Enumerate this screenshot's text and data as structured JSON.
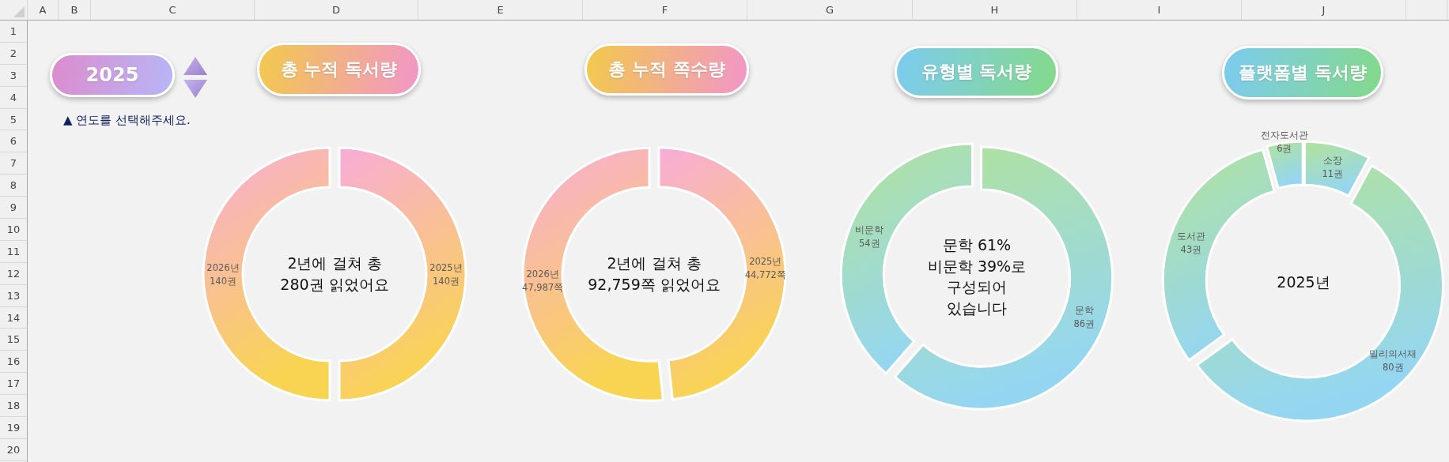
{
  "sheet": {
    "columns": [
      "A",
      "B",
      "C",
      "D",
      "E",
      "F",
      "G",
      "H",
      "I",
      "J",
      ""
    ],
    "rows": [
      "1",
      "2",
      "3",
      "4",
      "5",
      "6",
      "7",
      "8",
      "9",
      "10",
      "11",
      "12",
      "13",
      "14",
      "15",
      "16",
      "17",
      "18",
      "19",
      "20"
    ]
  },
  "year_selector": {
    "value": "2025",
    "hint": "▲ 연도를 선택해주세요."
  },
  "charts": [
    {
      "title": "총 누적 독서량",
      "kind": "warm",
      "center_text": [
        "2년에 걸쳐 총",
        "280권 읽었어요"
      ],
      "chart_data": {
        "type": "donut",
        "categories": [
          "2025년",
          "2026년"
        ],
        "values": [
          140,
          140
        ],
        "value_labels": [
          "140권",
          "140권"
        ]
      }
    },
    {
      "title": "총 누적 쪽수량",
      "kind": "warm",
      "center_text": [
        "2년에 걸쳐 총",
        "92,759쪽 읽었어요"
      ],
      "chart_data": {
        "type": "donut",
        "categories": [
          "2025년",
          "2026년"
        ],
        "values": [
          44772,
          47987
        ],
        "value_labels": [
          "44,772쪽",
          "47,987쪽"
        ]
      }
    },
    {
      "title": "유형별 독서량",
      "kind": "cool",
      "center_text": [
        "문학 61%",
        "비문학 39%로",
        "구성되어",
        "있습니다"
      ],
      "chart_data": {
        "type": "donut",
        "categories": [
          "문학",
          "비문학"
        ],
        "values": [
          86,
          54
        ],
        "value_labels": [
          "86권",
          "54권"
        ]
      }
    },
    {
      "title": "플랫폼별 독서량",
      "kind": "cool",
      "center_text": [
        "2025년"
      ],
      "chart_data": {
        "type": "donut",
        "categories": [
          "소장",
          "밀리의서재",
          "도서관",
          "전자도서관"
        ],
        "values": [
          11,
          80,
          43,
          6
        ],
        "value_labels": [
          "11권",
          "80권",
          "43권",
          "6권"
        ]
      }
    }
  ]
}
